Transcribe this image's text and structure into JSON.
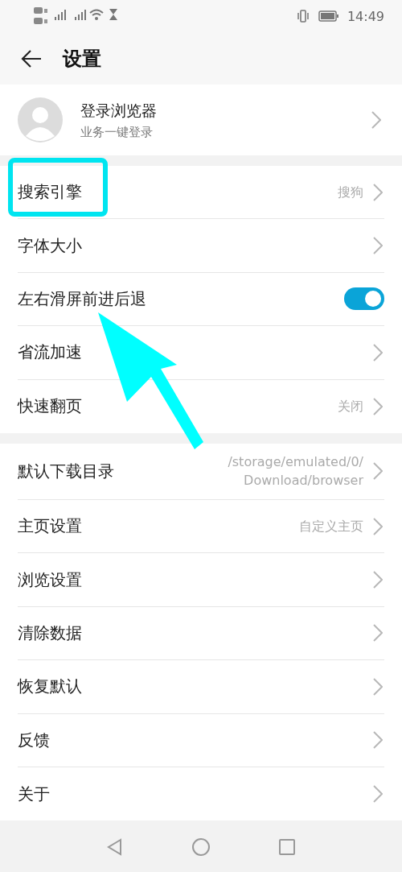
{
  "status_bar": {
    "time": "14:49"
  },
  "header": {
    "title": "设置"
  },
  "account": {
    "name": "登录浏览器",
    "subtitle": "业务一键登录"
  },
  "groups": [
    [
      {
        "kind": "link",
        "label": "搜索引擎",
        "value": "搜狗"
      },
      {
        "kind": "link",
        "label": "字体大小"
      },
      {
        "kind": "toggle",
        "label": "左右滑屏前进后退",
        "on": true
      },
      {
        "kind": "link",
        "label": "省流加速"
      },
      {
        "kind": "link",
        "label": "快速翻页",
        "value": "关闭"
      }
    ],
    [
      {
        "kind": "link",
        "label": "默认下载目录",
        "value": "/storage/emulated/0/\nDownload/browser"
      },
      {
        "kind": "link",
        "label": "主页设置",
        "value": "自定义主页"
      },
      {
        "kind": "link",
        "label": "浏览设置"
      },
      {
        "kind": "link",
        "label": "清除数据"
      },
      {
        "kind": "link",
        "label": "恢复默认"
      },
      {
        "kind": "link",
        "label": "反馈"
      },
      {
        "kind": "link",
        "label": "关于"
      }
    ]
  ]
}
